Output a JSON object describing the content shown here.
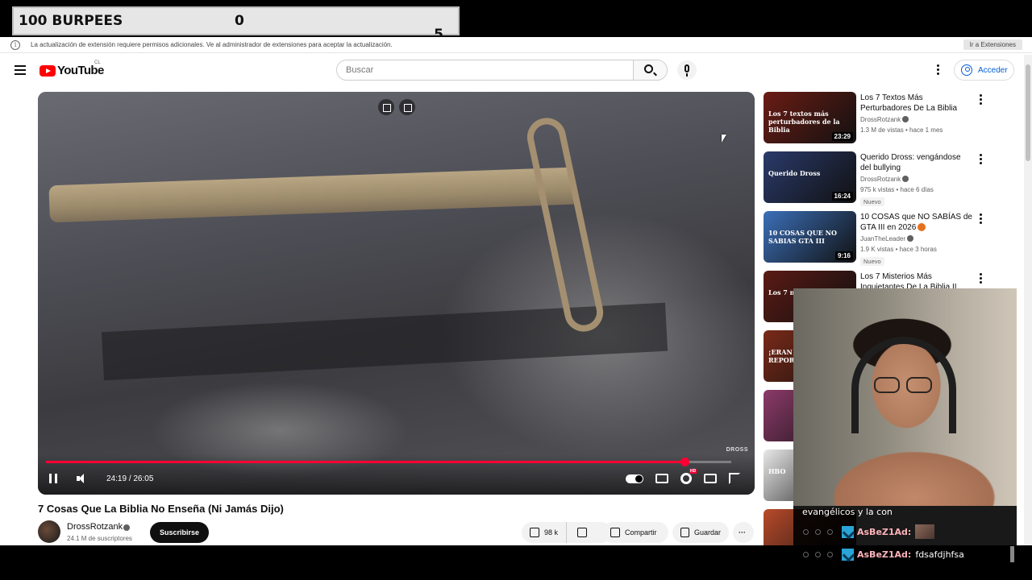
{
  "overlay_counter": {
    "title": "100 BURPEES",
    "middle": "0",
    "right": "5"
  },
  "infobar": {
    "message": "La actualización de extensión requiere permisos adicionales. Ve al administrador de extensiones para aceptar la actualización.",
    "button": "Ir a Extensiones"
  },
  "header": {
    "logo_text": "YouTube",
    "country_code": "CL",
    "search_placeholder": "Buscar",
    "login_label": "Acceder"
  },
  "player": {
    "current_time": "24:19",
    "separator": "/",
    "duration": "26:05",
    "progress_fraction": 0.932,
    "watermark": "DROSS"
  },
  "video": {
    "title": "7 Cosas Que La Biblia No Enseña (Ni Jamás Dijo)",
    "channel": "DrossRotzank",
    "subscribers": "24.1 M de suscriptores",
    "subscribe_label": "Suscribirse",
    "likes": "98 k",
    "share_label": "Compartir",
    "save_label": "Guardar",
    "more_label": "···"
  },
  "related": [
    {
      "title": "Los 7 Textos Más Perturbadores De La Biblia",
      "channel": "DrossRotzank",
      "meta": "1.3 M de vistas • hace 1 mes",
      "duration": "23:29",
      "badge": "",
      "thumb_caption": "Los 7 textos más perturbadores de la Biblia",
      "thumb_color": "#6b1c14"
    },
    {
      "title": "Querido Dross: vengándose del bullying",
      "channel": "DrossRotzank",
      "meta": "975 k vistas • hace 6 días",
      "duration": "16:24",
      "badge": "Nuevo",
      "thumb_caption": "Querido Dross",
      "thumb_color": "#2a3a6a"
    },
    {
      "title": "10 COSAS que NO SABÍAS de GTA III en 2026",
      "channel": "JuanTheLeader",
      "meta": "1.9 K vistas • hace 3 horas",
      "duration": "9:16",
      "badge": "Nuevo",
      "thumb_caption": "10 COSAS QUE NO SABIAS GTA III",
      "thumb_color": "#3b6fb8"
    },
    {
      "title": "Los 7 Misterios Más Inquietantes De La Biblia II",
      "channel": "",
      "meta": "",
      "duration": "",
      "badge": "",
      "thumb_caption": "Los 7 misterios",
      "thumb_color": "#5a1a14"
    },
    {
      "title": "",
      "channel": "",
      "meta": "",
      "duration": "",
      "badge": "",
      "thumb_caption": "¡ERAN MO EL REPORTE",
      "thumb_color": "#7a2a18"
    },
    {
      "title": "",
      "channel": "",
      "meta": "",
      "duration": "",
      "badge": "",
      "thumb_caption": "",
      "thumb_color": "#8c3a6a"
    },
    {
      "title": "",
      "channel": "",
      "meta": "",
      "duration": "",
      "badge": "",
      "thumb_caption": "HBO",
      "thumb_color": "#e8e8e8"
    },
    {
      "title": "",
      "channel": "",
      "meta": "",
      "duration": "",
      "badge": "",
      "thumb_caption": "",
      "thumb_color": "#b84a2a"
    }
  ],
  "chat": {
    "partial_line": "evangélicos y la con",
    "messages": [
      {
        "user": "AsBeZ1Ad:",
        "text": ""
      },
      {
        "user": "AsBeZ1Ad:",
        "text": "fdsafdjhfsa"
      }
    ]
  }
}
